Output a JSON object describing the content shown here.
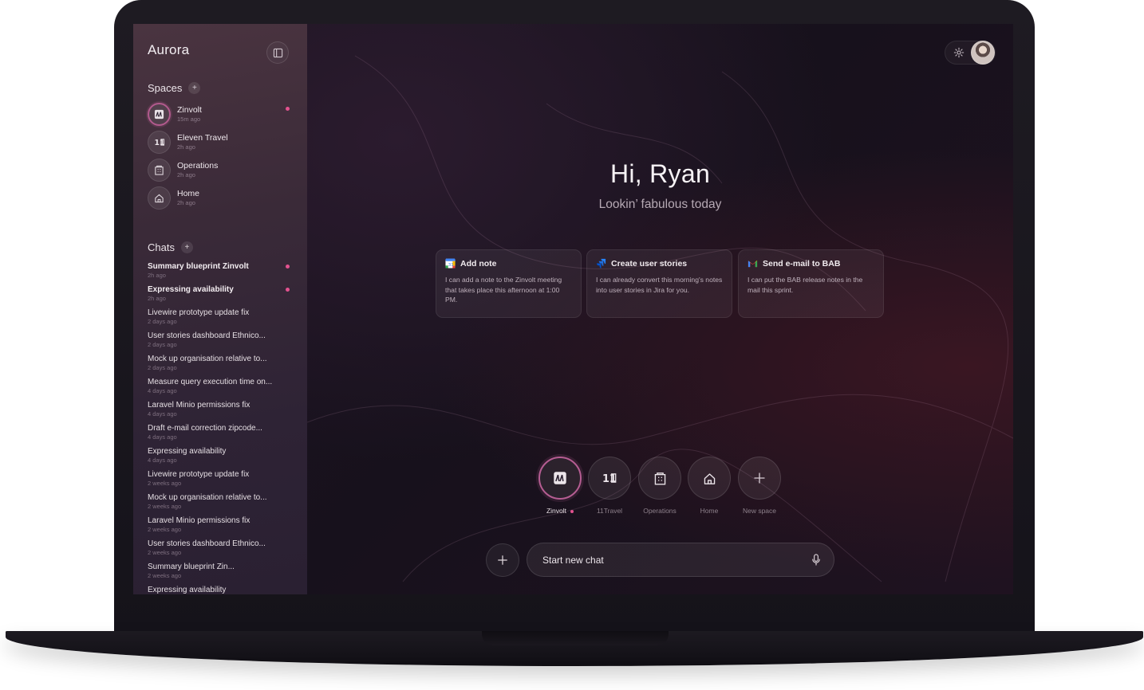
{
  "app": {
    "brand": "Aurora"
  },
  "sidebar": {
    "spaces_heading": "Spaces",
    "add_symbol": "+",
    "spaces": [
      {
        "name": "Zinvolt",
        "time": "15m ago",
        "active": true,
        "unread": true,
        "icon": "zinvolt-icon"
      },
      {
        "name": "Eleven Travel",
        "time": "2h ago",
        "active": false,
        "unread": false,
        "icon": "eleven-travel-icon"
      },
      {
        "name": "Operations",
        "time": "2h ago",
        "active": false,
        "unread": false,
        "icon": "building-icon"
      },
      {
        "name": "Home",
        "time": "2h ago",
        "active": false,
        "unread": false,
        "icon": "home-icon"
      }
    ],
    "chats_heading": "Chats",
    "chats": [
      {
        "title": "Summary blueprint Zinvolt",
        "time": "2h ago",
        "bold": true,
        "unread": true
      },
      {
        "title": "Expressing availability",
        "time": "2h ago",
        "bold": true,
        "unread": true
      },
      {
        "title": "Livewire prototype update fix",
        "time": "2 days ago",
        "bold": false,
        "unread": false
      },
      {
        "title": "User stories dashboard Ethnico...",
        "time": "2 days ago",
        "bold": false,
        "unread": false
      },
      {
        "title": "Mock up organisation relative to...",
        "time": "2 days ago",
        "bold": false,
        "unread": false
      },
      {
        "title": "Measure query execution time on...",
        "time": "4 days ago",
        "bold": false,
        "unread": false
      },
      {
        "title": "Laravel Minio permissions fix",
        "time": "4 days ago",
        "bold": false,
        "unread": false
      },
      {
        "title": "Draft e-mail correction zipcode...",
        "time": "4 days ago",
        "bold": false,
        "unread": false
      },
      {
        "title": "Expressing availability",
        "time": "4 days ago",
        "bold": false,
        "unread": false
      },
      {
        "title": "Livewire prototype update fix",
        "time": "2 weeks ago",
        "bold": false,
        "unread": false
      },
      {
        "title": "Mock up organisation relative to...",
        "time": "2 weeks ago",
        "bold": false,
        "unread": false
      },
      {
        "title": "Laravel Minio permissions fix",
        "time": "2 weeks ago",
        "bold": false,
        "unread": false
      },
      {
        "title": "User stories dashboard Ethnico...",
        "time": "2 weeks ago",
        "bold": false,
        "unread": false
      },
      {
        "title": "Summary blueprint Zin...",
        "time": "2 weeks ago",
        "bold": false,
        "unread": false
      },
      {
        "title": "Expressing availability",
        "time": "",
        "bold": false,
        "unread": false
      }
    ]
  },
  "main": {
    "greeting": "Hi, Ryan",
    "subgreeting": "Lookin’ fabulous today",
    "cards": [
      {
        "title": "Add note",
        "description": "I can add a note to the Zinvolt meeting that takes place this afternoon at 1:00 PM.",
        "icon": "google-calendar-icon"
      },
      {
        "title": "Create user stories",
        "description": "I can already convert this morning's notes into user stories in Jira for you.",
        "icon": "jira-icon"
      },
      {
        "title": "Send e-mail to BAB",
        "description": "I can put the BAB release notes in the mail this sprint.",
        "icon": "gmail-icon"
      }
    ],
    "space_bubbles": [
      {
        "label": "Zinvolt",
        "active": true,
        "unread": true
      },
      {
        "label": "11Travel",
        "active": false,
        "unread": false
      },
      {
        "label": "Operations",
        "active": false,
        "unread": false
      },
      {
        "label": "Home",
        "active": false,
        "unread": false
      },
      {
        "label": "New space",
        "active": false,
        "unread": false
      }
    ],
    "chat_input": {
      "placeholder": "Start new chat"
    },
    "add_symbol": "+"
  },
  "colors": {
    "accent": "#e3528f",
    "active_ring": "#b25a8d",
    "background": "#1a1320"
  }
}
